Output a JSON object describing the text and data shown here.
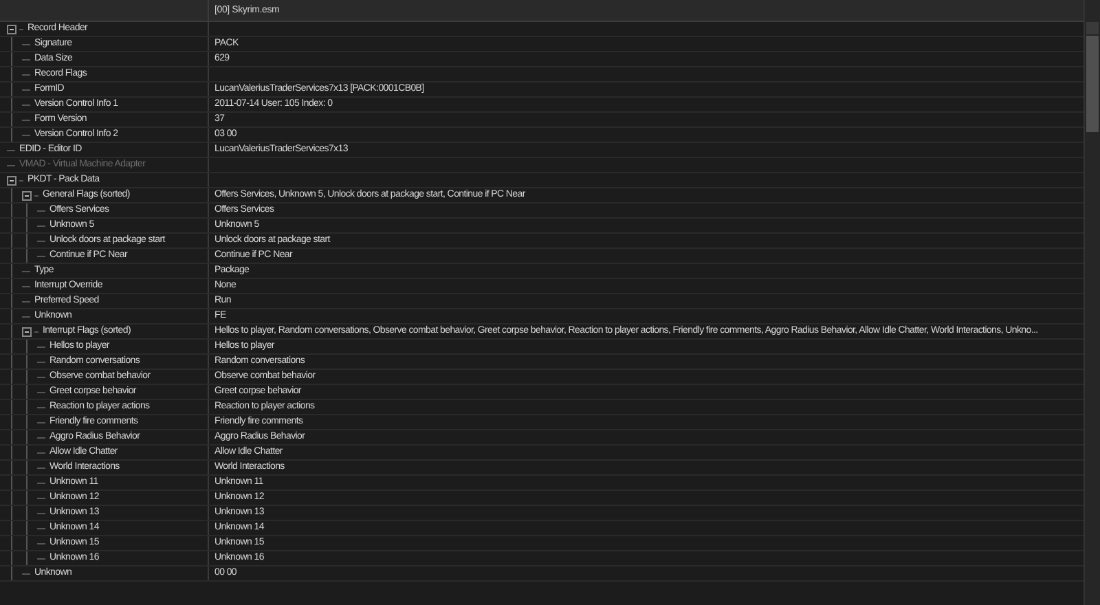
{
  "header": {
    "column_2": "[00] Skyrim.esm"
  },
  "tree": [
    {
      "label": "Record Header",
      "expanded": true,
      "disabled": false,
      "children": [
        {
          "label": "Signature",
          "value": "PACK",
          "disabled": false
        },
        {
          "label": "Data Size",
          "value": "629",
          "disabled": false
        },
        {
          "label": "Record Flags",
          "disabled": false
        },
        {
          "label": "FormID",
          "value": "LucanValeriusTraderServices7x13 [PACK:0001CB0B]",
          "disabled": false
        },
        {
          "label": "Version Control Info 1",
          "value": "2011-07-14 User: 105 Index: 0",
          "disabled": false
        },
        {
          "label": "Form Version",
          "value": "37",
          "disabled": false
        },
        {
          "label": "Version Control Info 2",
          "value": "03 00",
          "disabled": false
        }
      ]
    },
    {
      "label": "EDID - Editor ID",
      "value": "LucanValeriusTraderServices7x13",
      "disabled": false
    },
    {
      "label": "VMAD - Virtual Machine Adapter",
      "disabled": true
    },
    {
      "label": "PKDT - Pack Data",
      "expanded": true,
      "disabled": false,
      "children": [
        {
          "label": "General Flags (sorted)",
          "value": "Offers Services, Unknown 5, Unlock doors at package start, Continue if PC Near",
          "expanded": true,
          "disabled": false,
          "children": [
            {
              "label": "Offers Services",
              "value": "Offers Services",
              "disabled": false
            },
            {
              "label": "Unknown 5",
              "value": "Unknown 5",
              "disabled": false
            },
            {
              "label": "Unlock doors at package start",
              "value": "Unlock doors at package start",
              "disabled": false
            },
            {
              "label": "Continue if PC Near",
              "value": "Continue if PC Near",
              "disabled": false
            }
          ]
        },
        {
          "label": "Type",
          "value": "Package",
          "disabled": false
        },
        {
          "label": "Interrupt Override",
          "value": "None",
          "disabled": false
        },
        {
          "label": "Preferred Speed",
          "value": "Run",
          "disabled": false
        },
        {
          "label": "Unknown",
          "value": "FE",
          "disabled": false
        },
        {
          "label": "Interrupt Flags (sorted)",
          "value": "Hellos to player, Random conversations, Observe combat behavior, Greet corpse behavior, Reaction to player actions, Friendly fire comments, Aggro Radius Behavior, Allow Idle Chatter, World Interactions, Unkno...",
          "expanded": true,
          "disabled": false,
          "children": [
            {
              "label": "Hellos to player",
              "value": "Hellos to player",
              "disabled": false
            },
            {
              "label": "Random conversations",
              "value": "Random conversations",
              "disabled": false
            },
            {
              "label": "Observe combat behavior",
              "value": "Observe combat behavior",
              "disabled": false
            },
            {
              "label": "Greet corpse behavior",
              "value": "Greet corpse behavior",
              "disabled": false
            },
            {
              "label": "Reaction to player actions",
              "value": "Reaction to player actions",
              "disabled": false
            },
            {
              "label": "Friendly fire comments",
              "value": "Friendly fire comments",
              "disabled": false
            },
            {
              "label": "Aggro Radius Behavior",
              "value": "Aggro Radius Behavior",
              "disabled": false
            },
            {
              "label": "Allow Idle Chatter",
              "value": "Allow Idle Chatter",
              "disabled": false
            },
            {
              "label": "World Interactions",
              "value": "World Interactions",
              "disabled": false
            },
            {
              "label": "Unknown 11",
              "value": "Unknown 11",
              "disabled": false
            },
            {
              "label": "Unknown 12",
              "value": "Unknown 12",
              "disabled": false
            },
            {
              "label": "Unknown 13",
              "value": "Unknown 13",
              "disabled": false
            },
            {
              "label": "Unknown 14",
              "value": "Unknown 14",
              "disabled": false
            },
            {
              "label": "Unknown 15",
              "value": "Unknown 15",
              "disabled": false
            },
            {
              "label": "Unknown 16",
              "value": "Unknown 16",
              "disabled": false
            }
          ]
        },
        {
          "label": "Unknown",
          "value": "00 00",
          "disabled": false
        }
      ]
    }
  ]
}
